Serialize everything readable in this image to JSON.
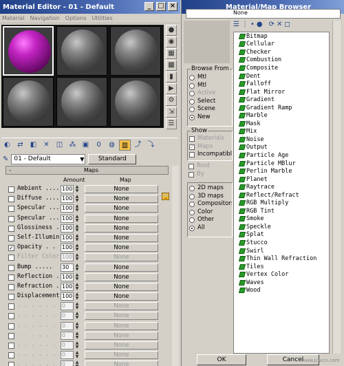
{
  "editor": {
    "title": "Material Editor - 01 - Default",
    "menu": [
      "Material",
      "Navigation",
      "Options",
      "Utilities"
    ],
    "slot_selected_color": "#c224c2",
    "material_name": "01 - Default",
    "type_button": "Standard",
    "maps": {
      "rollout_sign": "-",
      "rollout_title": "Maps",
      "col_amount": "Amount",
      "col_map": "Map",
      "rows": [
        {
          "label": "Ambient ....",
          "checked": false,
          "amount": "100",
          "map": "None",
          "disabled": false
        },
        {
          "label": "Diffuse ....",
          "checked": false,
          "amount": "100",
          "map": "None",
          "disabled": false
        },
        {
          "label": "Specular ...",
          "checked": false,
          "amount": "100",
          "map": "None",
          "disabled": false
        },
        {
          "label": "Specular ...",
          "checked": false,
          "amount": "100",
          "map": "None",
          "disabled": false
        },
        {
          "label": "Glossiness ..",
          "checked": false,
          "amount": "100",
          "map": "None",
          "disabled": false
        },
        {
          "label": "Self-Illumin",
          "checked": false,
          "amount": "100",
          "map": "None",
          "disabled": false
        },
        {
          "label": "Opacity . .",
          "checked": true,
          "amount": "100",
          "map": "None",
          "disabled": false
        },
        {
          "label": "Filter Color",
          "checked": false,
          "amount": "100",
          "map": "None",
          "disabled": true
        },
        {
          "label": "Bump .....",
          "checked": false,
          "amount": "30",
          "map": "None",
          "disabled": false
        },
        {
          "label": "Reflection .",
          "checked": false,
          "amount": "100",
          "map": "None",
          "disabled": false
        },
        {
          "label": "Refraction .",
          "checked": false,
          "amount": "100",
          "map": "None",
          "disabled": false
        },
        {
          "label": "Displacement",
          "checked": false,
          "amount": "100",
          "map": "None",
          "disabled": false
        },
        {
          "label": ". . . . . . .",
          "checked": false,
          "amount": "0",
          "map": "None",
          "disabled": true
        },
        {
          "label": ". . . . . . .",
          "checked": false,
          "amount": "0",
          "map": "None",
          "disabled": true
        },
        {
          "label": ". . . . . . .",
          "checked": false,
          "amount": "0",
          "map": "None",
          "disabled": true
        },
        {
          "label": ". . . . . . .",
          "checked": false,
          "amount": "0",
          "map": "None",
          "disabled": true
        },
        {
          "label": ". . . . . . .",
          "checked": false,
          "amount": "0",
          "map": "None",
          "disabled": true
        },
        {
          "label": ". . . . . . .",
          "checked": false,
          "amount": "0",
          "map": "None",
          "disabled": true
        },
        {
          "label": ". . . . . . .",
          "checked": false,
          "amount": "0",
          "map": "None",
          "disabled": true
        },
        {
          "label": ". . . . . . .",
          "checked": false,
          "amount": "0",
          "map": "None",
          "disabled": true
        }
      ]
    }
  },
  "browser": {
    "title": "Material/Map Browser",
    "current": "None",
    "browse_from": {
      "title": "Browse From",
      "options": [
        "Mtl",
        "Mtl",
        "Active",
        "Select",
        "Scene",
        "New"
      ],
      "selected": 5,
      "disabled": [
        2
      ]
    },
    "show": {
      "title": "Show",
      "options": [
        "Materials",
        "Maps",
        "Incompatible"
      ],
      "checked": [
        1
      ],
      "disabled": [
        0,
        1
      ]
    },
    "root": {
      "options": [
        "Root",
        "By"
      ],
      "disabled": [
        0,
        1
      ]
    },
    "category": {
      "options": [
        "2D maps",
        "3D maps",
        "Compositors",
        "Color",
        "Other",
        "All"
      ],
      "selected": 5
    },
    "maps": [
      "Bitmap",
      "Cellular",
      "Checker",
      "Combustion",
      "Composite",
      "Dent",
      "Falloff",
      "Flat Mirror",
      "Gradient",
      "Gradient Ramp",
      "Marble",
      "Mask",
      "Mix",
      "Noise",
      "Output",
      "Particle Age",
      "Particle MBlur",
      "Perlin Marble",
      "Planet",
      "Raytrace",
      "Reflect/Refract",
      "RGB Multiply",
      "RGB Tint",
      "Smoke",
      "Speckle",
      "Splat",
      "Stucco",
      "Swirl",
      "Thin Wall Refraction",
      "Tiles",
      "Vertex Color",
      "Waves",
      "Wood"
    ],
    "ok": "OK",
    "cancel": "Cancel",
    "watermark": "www.jcwcn.com",
    "map_icon_color": "#2a9a2a"
  }
}
